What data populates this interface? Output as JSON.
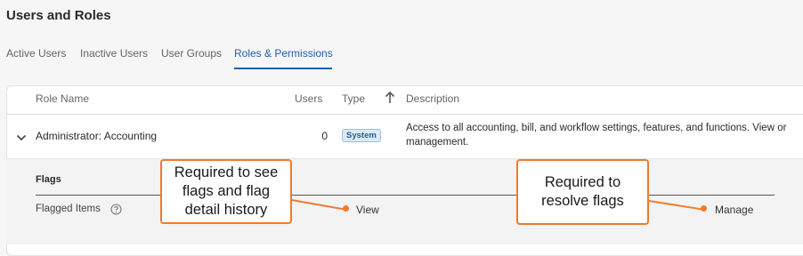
{
  "page": {
    "title": "Users and Roles"
  },
  "tabs": [
    {
      "label": "Active Users",
      "active": false
    },
    {
      "label": "Inactive Users",
      "active": false
    },
    {
      "label": "User Groups",
      "active": false
    },
    {
      "label": "Roles & Permissions",
      "active": true
    }
  ],
  "table": {
    "headers": {
      "role_name": "Role Name",
      "users": "Users",
      "type": "Type",
      "description": "Description"
    },
    "sort_icon": "arrow-up-icon",
    "rows": [
      {
        "role_name": "Administrator: Accounting",
        "users": "0",
        "type_badge": "System",
        "description_line1": "Access to all accounting, bill, and workflow settings, features, and functions. View or",
        "description_line2": "management.",
        "expanded": true,
        "expand_icon": "chevron-down-icon"
      }
    ]
  },
  "permissions": {
    "section_title": "Flags",
    "items": [
      {
        "label": "Flagged Items",
        "help_icon": "question-circle-icon",
        "view": "View",
        "manage": "Manage"
      }
    ]
  },
  "annotations": [
    {
      "text_lines": [
        "Required to see",
        "flags and flag",
        "detail history"
      ]
    },
    {
      "text_lines": [
        "Required to",
        "resolve flags"
      ]
    }
  ],
  "colors": {
    "accent": "#1f5fa8",
    "annotation": "#ef7b2c",
    "badge_bg": "#dce9f7",
    "badge_text": "#2d5a8e"
  }
}
